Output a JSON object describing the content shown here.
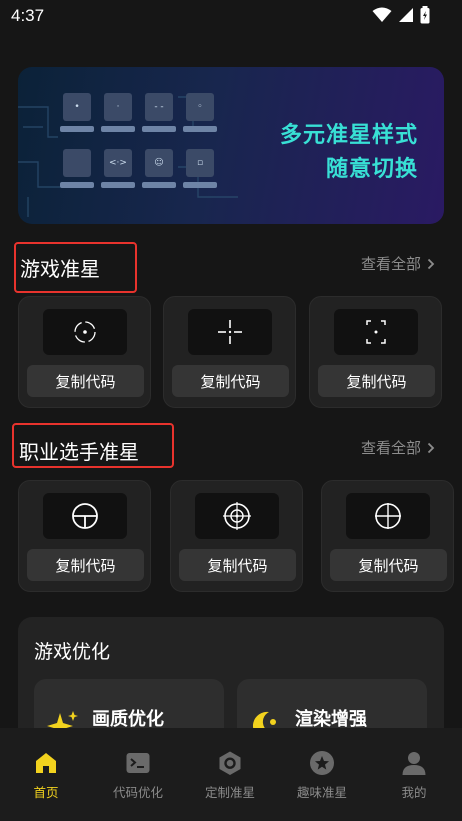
{
  "status": {
    "time": "4:37"
  },
  "banner": {
    "line1": "多元准星样式",
    "line2": "随意切换"
  },
  "sections": {
    "game": {
      "title": "游戏准星",
      "view_all": "查看全部"
    },
    "pro": {
      "title": "职业选手准星",
      "view_all": "查看全部"
    }
  },
  "game_cards": [
    {
      "icon": "dot-circle-crosshair-icon",
      "button": "复制代码"
    },
    {
      "icon": "gap-cross-crosshair-icon",
      "button": "复制代码"
    },
    {
      "icon": "bracket-dot-crosshair-icon",
      "button": "复制代码"
    }
  ],
  "pro_cards": [
    {
      "icon": "t-scope-crosshair-icon",
      "button": "复制代码"
    },
    {
      "icon": "target-scope-crosshair-icon",
      "button": "复制代码"
    },
    {
      "icon": "cross-scope-crosshair-icon",
      "button": "复制代码"
    }
  ],
  "optimization": {
    "title": "游戏优化",
    "items": [
      {
        "icon": "sparkle-icon",
        "label": "画质优化"
      },
      {
        "icon": "crescent-icon",
        "label": "渲染增强"
      }
    ]
  },
  "tabbar": {
    "items": [
      {
        "icon": "home-icon",
        "label": "首页",
        "active": true
      },
      {
        "icon": "terminal-icon",
        "label": "代码优化"
      },
      {
        "icon": "hexagon-icon",
        "label": "定制准星"
      },
      {
        "icon": "star-badge-icon",
        "label": "趣味准星"
      },
      {
        "icon": "user-icon",
        "label": "我的"
      }
    ]
  },
  "colors": {
    "accent": "#f2d21e",
    "highlight_box": "#e8332d",
    "banner_text": "#38e0d5"
  }
}
